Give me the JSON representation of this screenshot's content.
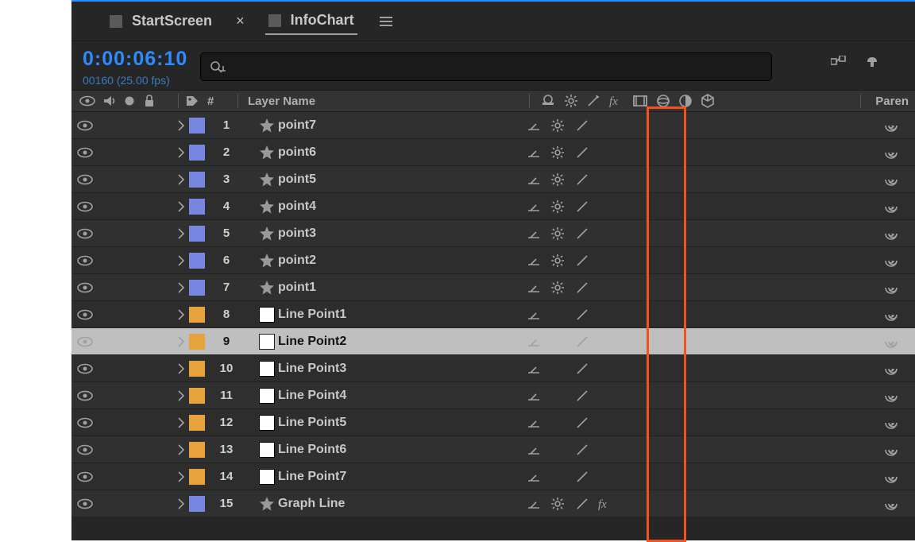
{
  "tabs": [
    {
      "label": "StartScreen",
      "active": false
    },
    {
      "label": "InfoChart",
      "active": true
    }
  ],
  "timecode": "0:00:06:10",
  "frames": "00160 (25.00 fps)",
  "search": {
    "placeholder": ""
  },
  "columns": {
    "number": "#",
    "layerName": "Layer Name",
    "parent": "Paren"
  },
  "layers": [
    {
      "idx": 1,
      "name": "point7",
      "type": "shape",
      "color": "blue",
      "sun": true,
      "fx": false,
      "selected": false
    },
    {
      "idx": 2,
      "name": "point6",
      "type": "shape",
      "color": "blue",
      "sun": true,
      "fx": false,
      "selected": false
    },
    {
      "idx": 3,
      "name": "point5",
      "type": "shape",
      "color": "blue",
      "sun": true,
      "fx": false,
      "selected": false
    },
    {
      "idx": 4,
      "name": "point4",
      "type": "shape",
      "color": "blue",
      "sun": true,
      "fx": false,
      "selected": false
    },
    {
      "idx": 5,
      "name": "point3",
      "type": "shape",
      "color": "blue",
      "sun": true,
      "fx": false,
      "selected": false
    },
    {
      "idx": 6,
      "name": "point2",
      "type": "shape",
      "color": "blue",
      "sun": true,
      "fx": false,
      "selected": false
    },
    {
      "idx": 7,
      "name": "point1",
      "type": "shape",
      "color": "blue",
      "sun": true,
      "fx": false,
      "selected": false
    },
    {
      "idx": 8,
      "name": "Line Point1",
      "type": "solid",
      "color": "orange",
      "sun": false,
      "fx": false,
      "selected": false
    },
    {
      "idx": 9,
      "name": "Line Point2",
      "type": "solid",
      "color": "orange",
      "sun": false,
      "fx": false,
      "selected": true
    },
    {
      "idx": 10,
      "name": "Line Point3",
      "type": "solid",
      "color": "orange",
      "sun": false,
      "fx": false,
      "selected": false
    },
    {
      "idx": 11,
      "name": "Line Point4",
      "type": "solid",
      "color": "orange",
      "sun": false,
      "fx": false,
      "selected": false
    },
    {
      "idx": 12,
      "name": "Line Point5",
      "type": "solid",
      "color": "orange",
      "sun": false,
      "fx": false,
      "selected": false
    },
    {
      "idx": 13,
      "name": "Line Point6",
      "type": "solid",
      "color": "orange",
      "sun": false,
      "fx": false,
      "selected": false
    },
    {
      "idx": 14,
      "name": "Line Point7",
      "type": "solid",
      "color": "orange",
      "sun": false,
      "fx": false,
      "selected": false
    },
    {
      "idx": 15,
      "name": "Graph Line",
      "type": "shape",
      "color": "blue",
      "sun": true,
      "fx": true,
      "selected": false
    }
  ]
}
